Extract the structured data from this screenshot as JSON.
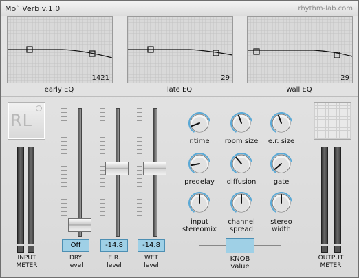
{
  "header": {
    "title": "Mo` Verb v.1.0",
    "brand": "rhythm-lab.com"
  },
  "logo": {
    "text": "RL"
  },
  "eq": [
    {
      "label": "early EQ",
      "value": "1421"
    },
    {
      "label": "late EQ",
      "value": "29"
    },
    {
      "label": "wall EQ",
      "value": "29"
    }
  ],
  "faders": [
    {
      "value": "Off",
      "label_line1": "DRY",
      "label_line2": "level",
      "position": 0.02
    },
    {
      "value": "-14.8",
      "label_line1": "E.R.",
      "label_line2": "level",
      "position": 0.52
    },
    {
      "value": "-14.8",
      "label_line1": "WET",
      "label_line2": "level",
      "position": 0.52
    }
  ],
  "knobs": [
    {
      "label": "r.time"
    },
    {
      "label": "room size"
    },
    {
      "label": "e.r. size"
    },
    {
      "label": "predelay"
    },
    {
      "label": "diffusion"
    },
    {
      "label": "gate"
    },
    {
      "label_line1": "input",
      "label_line2": "stereomix"
    },
    {
      "label_line1": "channel",
      "label_line2": "spread"
    },
    {
      "label_line1": "stereo",
      "label_line2": "width"
    }
  ],
  "knob_value": {
    "label_line1": "KNOB",
    "label_line2": "value"
  },
  "meters": {
    "input": {
      "line1": "INPUT",
      "line2": "METER"
    },
    "output": {
      "line1": "OUTPUT",
      "line2": "METER"
    }
  },
  "colors": {
    "accent": "#9fd0e6",
    "accent_border": "#4d8fb3",
    "knob_highlight": "#5aa9d6"
  },
  "icons": [
    "knob-icon",
    "fader-handle-icon",
    "meter-icon"
  ]
}
